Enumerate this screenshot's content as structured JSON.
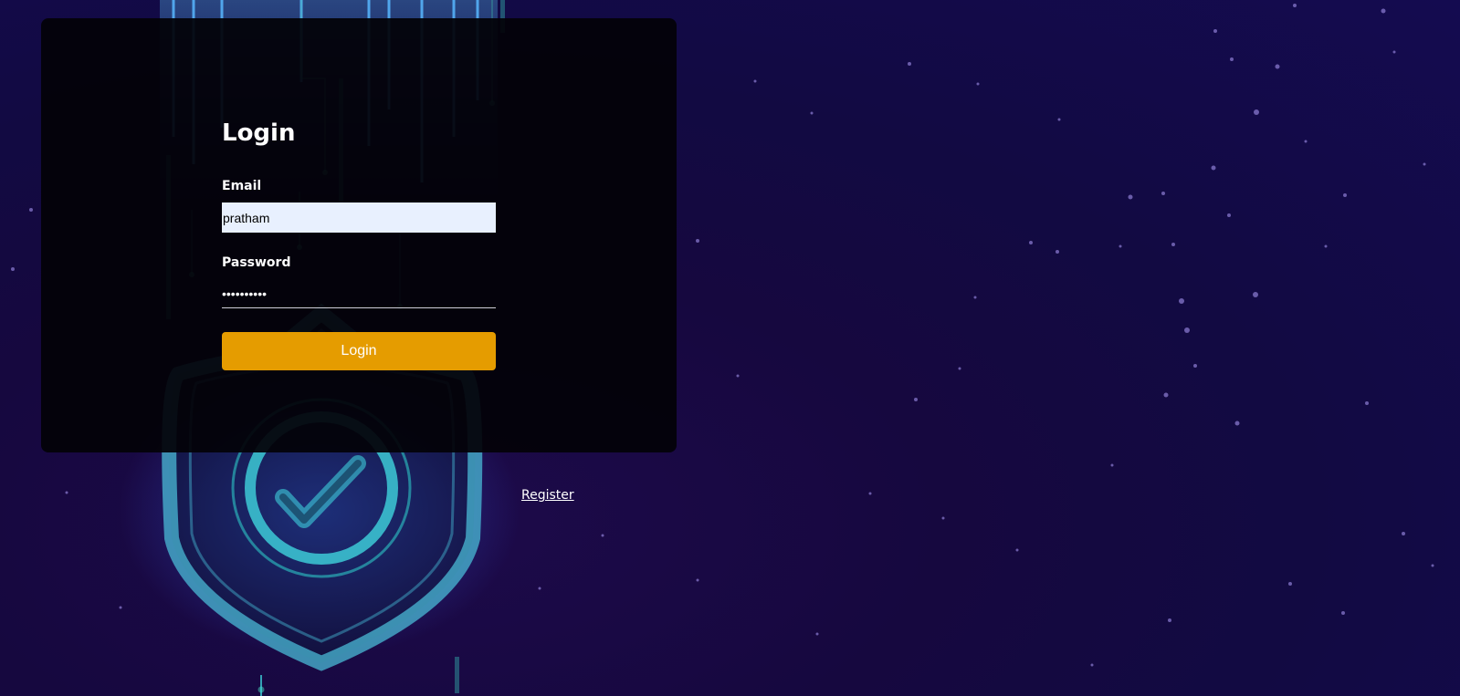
{
  "login": {
    "title": "Login",
    "email_label": "Email",
    "email_value": "pratham",
    "password_label": "Password",
    "password_value": "••••••••••",
    "submit_label": "Login"
  },
  "register": {
    "link_label": "Register"
  },
  "background": {
    "illustration": "shield-check-icon",
    "accent_color": "#41e0e6",
    "button_color": "#e59c00"
  }
}
